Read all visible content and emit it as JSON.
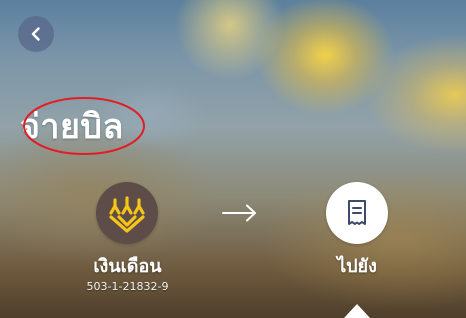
{
  "header": {
    "back_icon": "chevron-left-icon",
    "title": "จ่ายบิล",
    "title_highlight_color": "#e01e24"
  },
  "transfer": {
    "from": {
      "logo_icon": "krungsri-bank-logo",
      "logo_bg_color": "#5d4c48",
      "logo_accent_color": "#f5c518",
      "name": "เงินเดือน",
      "account_number": "503-1-21832-9"
    },
    "arrow_icon": "arrow-right-icon",
    "to": {
      "icon": "bill-receipt-icon",
      "label": "ไปยัง"
    }
  }
}
